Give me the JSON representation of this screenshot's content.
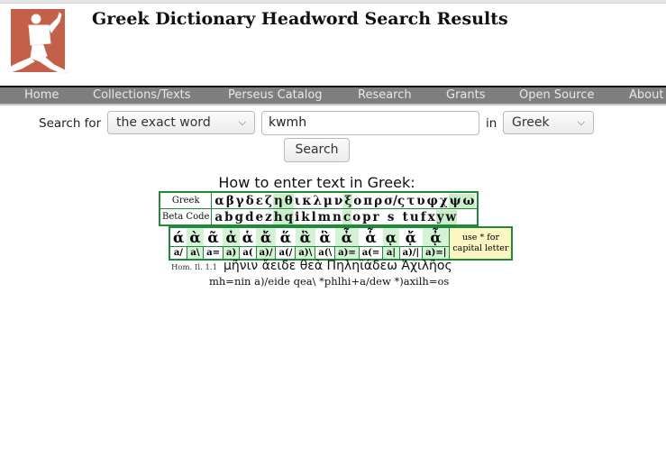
{
  "page": {
    "title": "Greek Dictionary Headword Search Results"
  },
  "colors": {
    "logo_bg": "#c4604a",
    "nav_bg": "#7e7e7e",
    "table_border": "#1f8a3a",
    "highlight": "#c9efc9",
    "note_bg": "#fbf6c2"
  },
  "nav": {
    "items": [
      "Home",
      "Collections/Texts",
      "Perseus Catalog",
      "Research",
      "Grants",
      "Open Source",
      "About"
    ]
  },
  "search": {
    "label": "Search for",
    "mode_value": "the exact word",
    "query_value": "kwmh",
    "in_label": "in",
    "language_value": "Greek",
    "button_label": "Search"
  },
  "help": {
    "heading": "How to enter text in Greek:",
    "greek_label": "Greek",
    "beta_label": "Beta Code",
    "letters": [
      {
        "g": "α",
        "b": "a",
        "hl": false
      },
      {
        "g": "β",
        "b": "b",
        "hl": false
      },
      {
        "g": "γ",
        "b": "g",
        "hl": false
      },
      {
        "g": "δ",
        "b": "d",
        "hl": false
      },
      {
        "g": "ε",
        "b": "e",
        "hl": false
      },
      {
        "g": "ζ",
        "b": "z",
        "hl": false
      },
      {
        "g": "η",
        "b": "h",
        "hl": true
      },
      {
        "g": "θ",
        "b": "q",
        "hl": true
      },
      {
        "g": "ι",
        "b": "i",
        "hl": false
      },
      {
        "g": "κ",
        "b": "k",
        "hl": false
      },
      {
        "g": "λ",
        "b": "l",
        "hl": false
      },
      {
        "g": "μ",
        "b": "m",
        "hl": false
      },
      {
        "g": "ν",
        "b": "n",
        "hl": false
      },
      {
        "g": "ξ",
        "b": "c",
        "hl": true
      },
      {
        "g": "ο",
        "b": "o",
        "hl": false
      },
      {
        "g": "π",
        "b": "p",
        "hl": false
      },
      {
        "g": "ρ",
        "b": "r",
        "hl": false
      },
      {
        "g": "σ/ς",
        "b": "s",
        "hl": false
      },
      {
        "g": "τ",
        "b": "t",
        "hl": false
      },
      {
        "g": "υ",
        "b": "u",
        "hl": false
      },
      {
        "g": "φ",
        "b": "f",
        "hl": false
      },
      {
        "g": "χ",
        "b": "x",
        "hl": false
      },
      {
        "g": "ψ",
        "b": "y",
        "hl": true
      },
      {
        "g": "ω",
        "b": "w",
        "hl": true
      }
    ],
    "accents": [
      {
        "g": "ά",
        "b": "a/"
      },
      {
        "g": "ὰ",
        "b": "a\\"
      },
      {
        "g": "ᾶ",
        "b": "a="
      },
      {
        "g": "ἀ",
        "b": "a)"
      },
      {
        "g": "ἁ",
        "b": "a("
      },
      {
        "g": "ἄ",
        "b": "a)/"
      },
      {
        "g": "ἅ",
        "b": "a(/"
      },
      {
        "g": "ἂ",
        "b": "a)\\"
      },
      {
        "g": "ἃ",
        "b": "a(\\"
      },
      {
        "g": "ἆ",
        "b": "a)="
      },
      {
        "g": "ἇ",
        "b": "a(="
      },
      {
        "g": "ᾳ",
        "b": "a|"
      },
      {
        "g": "ᾄ",
        "b": "a)/|"
      },
      {
        "g": "ᾆ",
        "b": "a)=|"
      }
    ],
    "capital_note": "use * for capital letter",
    "example_ref": "Hom. Il. 1.1",
    "example_greek": "μῆνιν ἄειδε θεὰ Πηληϊάδεω Ἀχιλῆος",
    "example_beta": "mh=nin a)/eide qea\\ *phlhi+a/dew *)axilh=os"
  }
}
